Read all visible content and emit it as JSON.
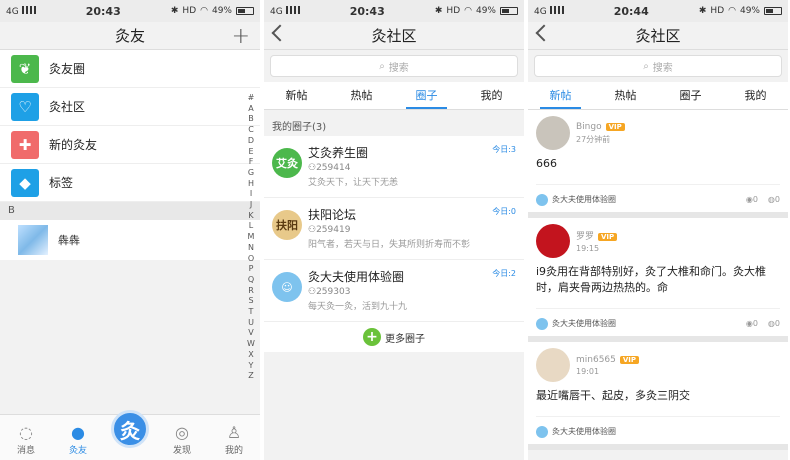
{
  "status": [
    {
      "network": "4G",
      "time": "20:43",
      "battery": "49%",
      "hd": "HD"
    },
    {
      "network": "4G",
      "time": "20:43",
      "battery": "49%",
      "hd": "HD"
    },
    {
      "network": "4G",
      "time": "20:44",
      "battery": "49%",
      "hd": "HD"
    }
  ],
  "panel1": {
    "title": "灸友",
    "items": [
      {
        "label": "灸友圈",
        "color": "#4cb84c"
      },
      {
        "label": "灸社区",
        "color": "#1ea0e6"
      },
      {
        "label": "新的灸友",
        "color": "#f06b6b"
      },
      {
        "label": "标签",
        "color": "#1ea0e6"
      }
    ],
    "section": "B",
    "friend": "犇犇",
    "alphabet": [
      "#",
      "A",
      "B",
      "C",
      "D",
      "E",
      "F",
      "G",
      "H",
      "I",
      "J",
      "K",
      "L",
      "M",
      "N",
      "O",
      "P",
      "Q",
      "R",
      "S",
      "T",
      "U",
      "V",
      "W",
      "X",
      "Y",
      "Z"
    ],
    "tabs": [
      {
        "label": "消息"
      },
      {
        "label": "灸友"
      },
      {
        "label": "发现"
      },
      {
        "label": "我的"
      }
    ],
    "center_glyph": "灸"
  },
  "panel2": {
    "title": "灸社区",
    "search_placeholder": "搜索",
    "tabs": [
      "新帖",
      "热帖",
      "圈子",
      "我的"
    ],
    "section": "我的圈子(3)",
    "circles": [
      {
        "name": "艾灸养生圈",
        "members": "259414",
        "desc": "艾灸天下，让天下无恙",
        "today": "今日:3",
        "color": "#4cb84c",
        "logo": "艾灸"
      },
      {
        "name": "扶阳论坛",
        "members": "259419",
        "desc": "阳气者，若天与日，失其所则折寿而不彰",
        "today": "今日:0",
        "color": "#e8c98a",
        "logo": "扶阳"
      },
      {
        "name": "灸大夫使用体验圈",
        "members": "259303",
        "desc": "每天灸一灸，活到九十九",
        "today": "今日:2",
        "color": "#7ec3ee",
        "logo": ""
      }
    ],
    "more": "更多圈子"
  },
  "panel3": {
    "title": "灸社区",
    "search_placeholder": "搜索",
    "tabs": [
      "新帖",
      "热帖",
      "圈子",
      "我的"
    ],
    "posts": [
      {
        "user": "Bingo",
        "vip": "VIP",
        "time": "27分钟前",
        "body": "666",
        "circle": "灸大夫使用体验圈",
        "views": "0",
        "comments": "0",
        "avatar": "#c9c4bb"
      },
      {
        "user": "罗罗",
        "vip": "VIP",
        "time": "19:15",
        "body": "i9灸用在背部特别好，灸了大椎和命门。灸大椎时，肩夹骨两边热热的。命",
        "circle": "灸大夫使用体验圈",
        "views": "0",
        "comments": "0",
        "avatar": "#c3141e"
      },
      {
        "user": "min6565",
        "vip": "VIP",
        "time": "19:01",
        "body": "最近嘴唇干、起皮，多灸三阴交",
        "circle": "灸大夫使用体验圈",
        "views": "",
        "comments": "",
        "avatar": "#e8d9c4"
      }
    ]
  }
}
